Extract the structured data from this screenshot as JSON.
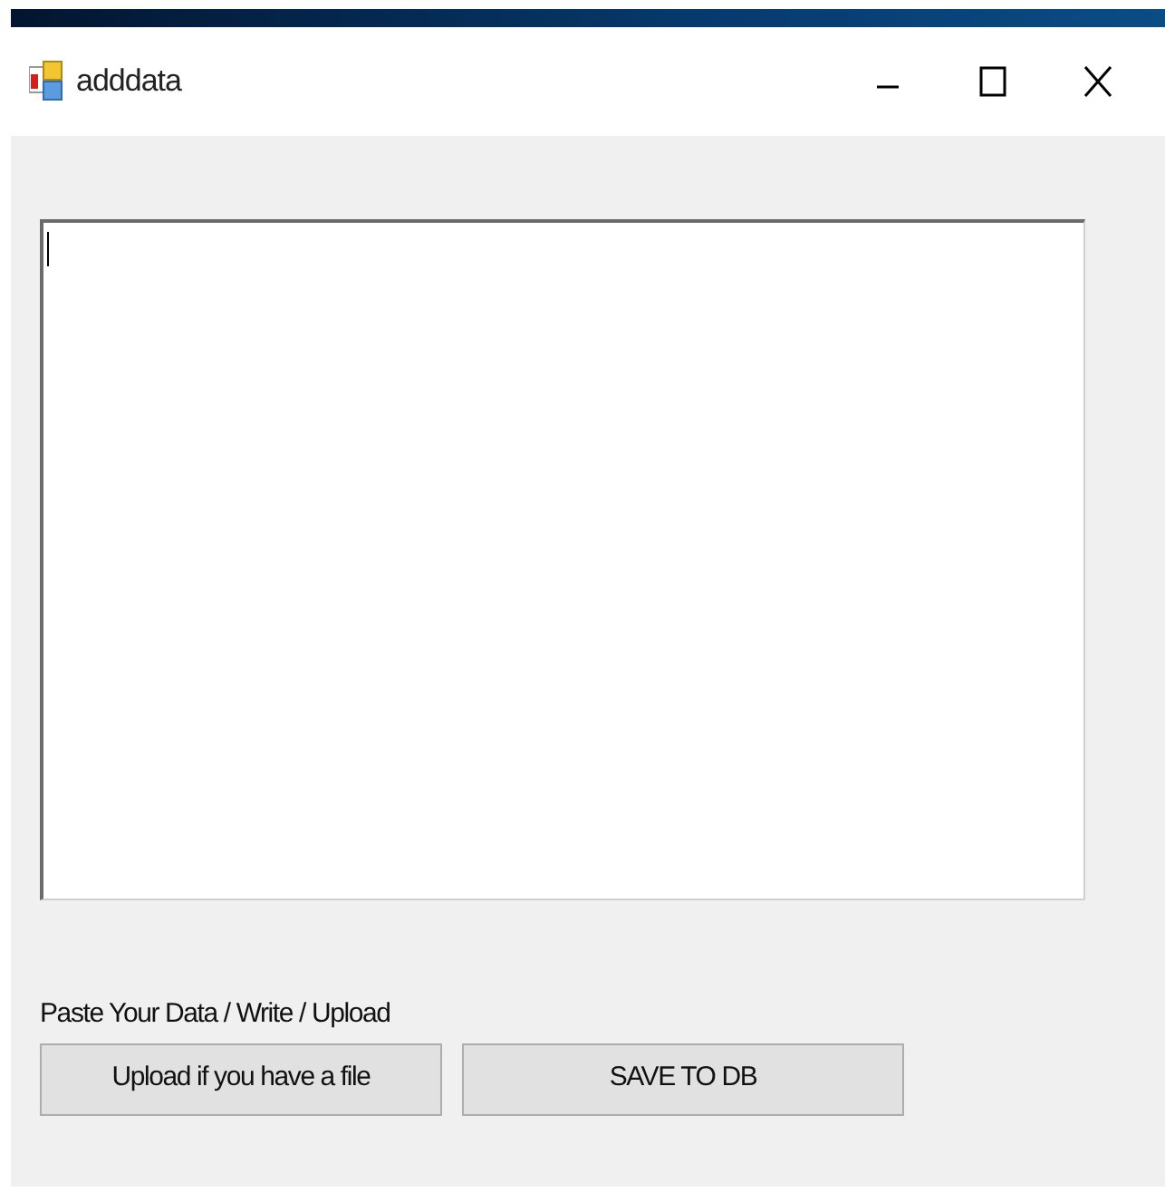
{
  "window": {
    "title": "adddata"
  },
  "textbox": {
    "focused": true
  },
  "label": "Paste Your Data / Write / Upload",
  "buttons": [
    "Upload if you have a file",
    "SAVE TO DB"
  ]
}
